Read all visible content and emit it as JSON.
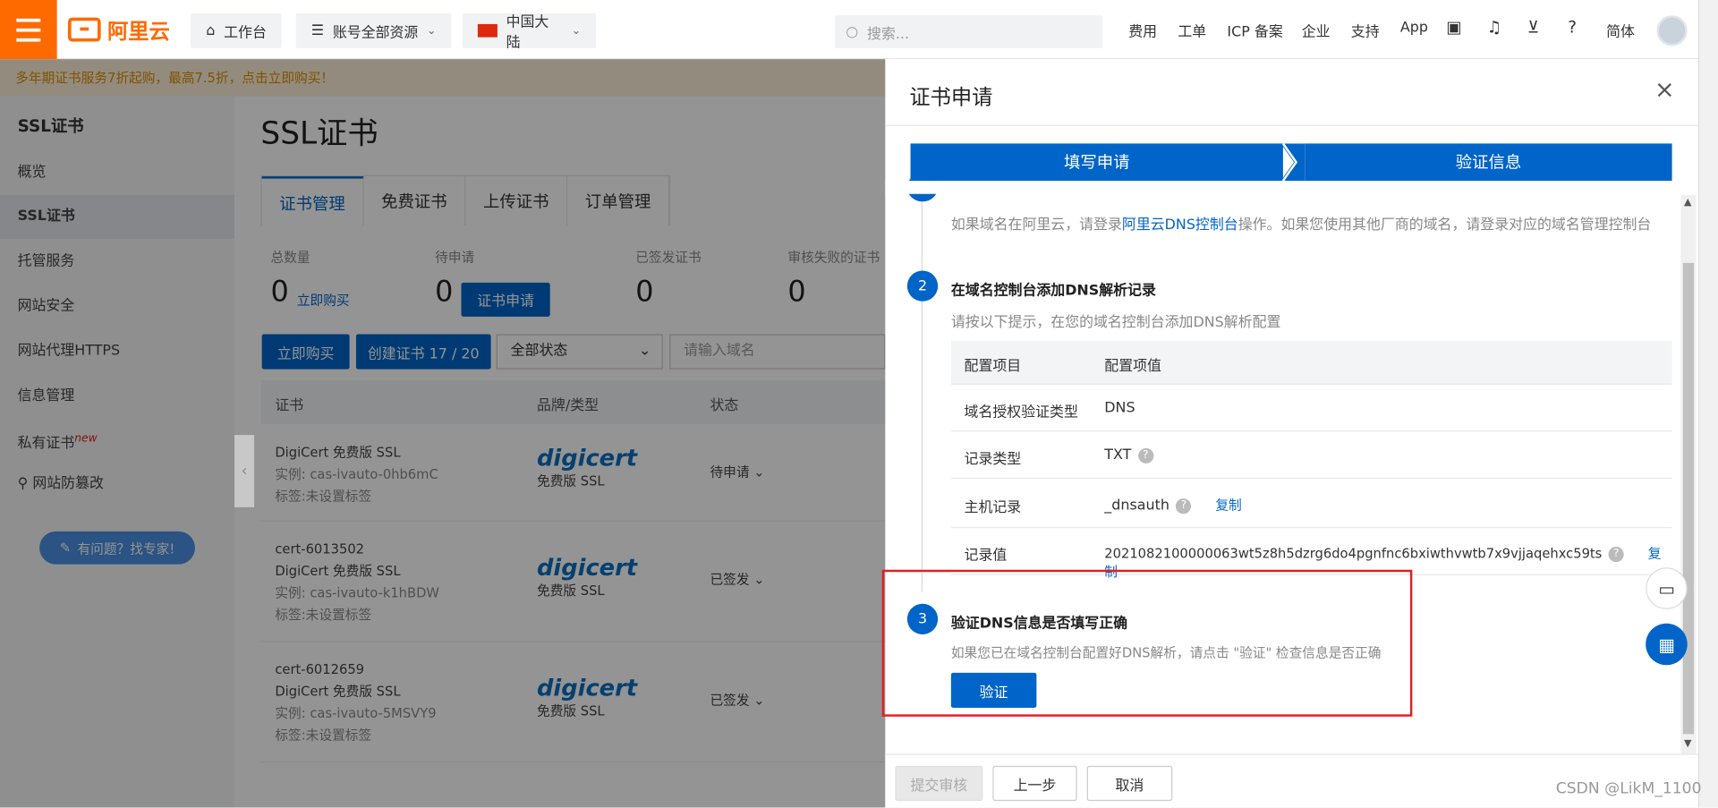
{
  "header": {
    "logo": "阿里云",
    "workbench": "工作台",
    "resources": "账号全部资源",
    "region": "中国大陆",
    "search_placeholder": "搜索...",
    "nav": [
      "费用",
      "工单",
      "ICP 备案",
      "企业",
      "支持",
      "App"
    ],
    "lang": "简体"
  },
  "promo": "多年期证书服务7折起购，最高7.5折，点击立即购买！",
  "sidebar": {
    "title": "SSL证书",
    "items": [
      {
        "label": "概览"
      },
      {
        "label": "SSL证书"
      },
      {
        "label": "托管服务"
      },
      {
        "label": "网站安全"
      },
      {
        "label": "网站代理HTTPS"
      },
      {
        "label": "信息管理"
      },
      {
        "label": "私有证书",
        "badge": "new"
      },
      {
        "label": "网站防篡改"
      }
    ],
    "help": "有问题？找专家!"
  },
  "main": {
    "title": "SSL证书",
    "tabs": [
      "证书管理",
      "免费证书",
      "上传证书",
      "订单管理"
    ],
    "stats": [
      {
        "label": "总数量",
        "value": "0",
        "link": "立即购买"
      },
      {
        "label": "待申请",
        "value": "0",
        "button": "证书申请"
      },
      {
        "label": "已签发证书",
        "value": "0"
      },
      {
        "label": "审核失败的证书",
        "value": "0"
      }
    ],
    "buy_btn": "立即购买",
    "create_btn": "创建证书 17 / 20",
    "status_select": "全部状态",
    "domain_placeholder": "请输入域名",
    "table_headers": [
      "证书",
      "品牌/类型",
      "状态"
    ],
    "rows": [
      {
        "name": "",
        "type": "DigiCert 免费版 SSL",
        "instance": "实例: cas-ivauto-0hb6mC",
        "tag": "标签:未设置标签",
        "brand": "digicert",
        "edition": "免费版 SSL",
        "status": "待申请"
      },
      {
        "name": "cert-6013502",
        "type": "DigiCert 免费版 SSL",
        "instance": "实例: cas-ivauto-k1hBDW",
        "tag": "标签:未设置标签",
        "brand": "digicert",
        "edition": "免费版 SSL",
        "status": "已签发"
      },
      {
        "name": "cert-6012659",
        "type": "DigiCert 免费版 SSL",
        "instance": "实例: cas-ivauto-5MSVY9",
        "tag": "标签:未设置标签",
        "brand": "digicert",
        "edition": "免费版 SSL",
        "status": "已签发"
      }
    ]
  },
  "dialog": {
    "title": "证书申请",
    "steps": [
      "填写申请",
      "验证信息"
    ],
    "step1_desc_pre": "如果域名在阿里云，请登录",
    "step1_link": "阿里云DNS控制台",
    "step1_desc_post": "操作。如果您使用其他厂商的域名，请登录对应的域名管理控制台",
    "step2_num": "2",
    "step2_title": "在域名控制台添加DNS解析记录",
    "step2_desc": "请按以下提示，在您的域名控制台添加DNS解析配置",
    "table_head": [
      "配置项目",
      "配置项值"
    ],
    "table_rows": [
      {
        "k": "域名授权验证类型",
        "v": "DNS"
      },
      {
        "k": "记录类型",
        "v": "TXT"
      },
      {
        "k": "主机记录",
        "v": "_dnsauth",
        "copy": "复制"
      },
      {
        "k": "记录值",
        "v": "2021082100000063wt5z8h5dzrg6do4pgnfnc6bxiwthvwtb7x9vjjaqehxc59ts",
        "copy": "复制"
      }
    ],
    "step3_num": "3",
    "step3_title": "验证DNS信息是否填写正确",
    "step3_desc": "如果您已在域名控制台配置好DNS解析，请点击 \"验证\" 检查信息是否正确",
    "verify": "验证",
    "footer": [
      "提交审核",
      "上一步",
      "取消"
    ]
  },
  "watermark": "CSDN @LikM_1100"
}
